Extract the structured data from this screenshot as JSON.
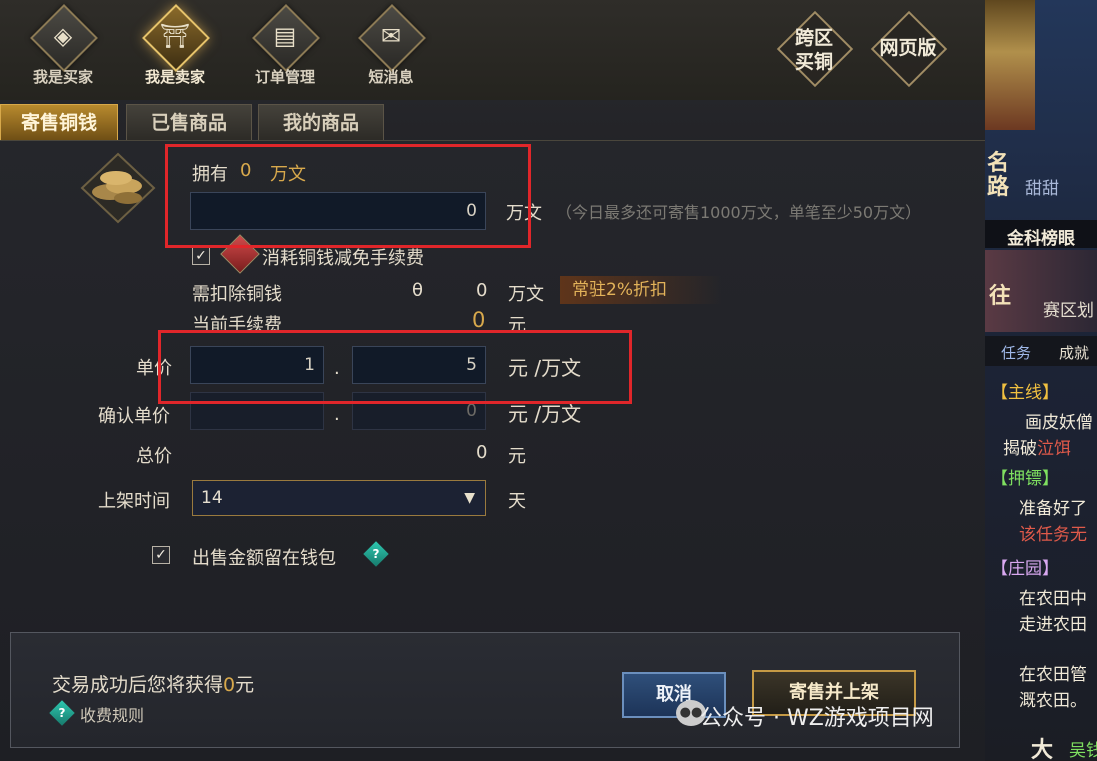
{
  "nav": {
    "buyer": {
      "label": "我是买家",
      "icon": "coin-icon"
    },
    "seller": {
      "label": "我是卖家",
      "icon": "stall-icon"
    },
    "orders": {
      "label": "订单管理",
      "icon": "ledger-icon"
    },
    "messages": {
      "label": "短消息",
      "icon": "envelope-icon"
    },
    "cross_server": {
      "label": "跨区\n买铜"
    },
    "web_version": {
      "label": "网页版"
    }
  },
  "tabs": {
    "sell_copper": "寄售铜钱",
    "sold_items": "已售商品",
    "my_items": "我的商品"
  },
  "form": {
    "own_label": "拥有",
    "own_value": "0",
    "own_unit": "万文",
    "amount_value": "0",
    "amount_unit": "万文",
    "amount_hint": "（今日最多还可寄售1000万文，单笔至少50万文）",
    "consume_checkbox_label": "消耗铜钱减免手续费",
    "deduct_label": "需扣除铜钱",
    "deduct_symbol": "θ",
    "deduct_value": "0",
    "deduct_unit": "万文",
    "discount_badge": "常驻2%折扣",
    "fee_label": "当前手续费",
    "fee_value": "0",
    "fee_unit": "元",
    "unit_price_label": "单价",
    "unit_price_int": "1",
    "unit_price_dec": "5",
    "unit_price_sep": ".",
    "unit_price_unit": "元 /万文",
    "confirm_price_label": "确认单价",
    "confirm_price_int": "",
    "confirm_price_dec": "0",
    "confirm_price_unit": "元 /万文",
    "total_label": "总价",
    "total_value": "0",
    "total_unit": "元",
    "listing_time_label": "上架时间",
    "listing_time_value": "14",
    "listing_time_unit": "天",
    "keep_in_wallet_label": "出售金额留在钱包"
  },
  "footer": {
    "receive_prefix": "交易成功后您将获得",
    "receive_value": "0",
    "receive_suffix": "元",
    "fee_rules": "收费规则",
    "cancel_button": "取消",
    "sell_button": "寄售并上架"
  },
  "sidebar": {
    "title_fragment": "名\n路",
    "sweet": "甜甜",
    "rank": "金科榜眼",
    "go": "往",
    "region": "赛区划",
    "tab_quest": "任务",
    "tab_achieve": "成就",
    "main_quest": "【主线】",
    "main_item": "画皮妖僧",
    "main_sub": "揭破",
    "main_sub_red": "泣饵",
    "escort": "【押镖】",
    "escort_item": "准备好了",
    "escort_sub": "该任务无",
    "estate": "【庄园】",
    "estate_item1": "在农田中",
    "estate_item2": "走进农田",
    "estate_item3": "在农田管",
    "estate_item4": "溉农田。",
    "big": "大",
    "wu": "吴钱"
  },
  "watermark": "公众号 · WZ游戏项目网",
  "colors": {
    "accent_gold": "#d8a94c",
    "highlight_red": "#e0262a",
    "cancel_blue": "#2f4f7a"
  }
}
